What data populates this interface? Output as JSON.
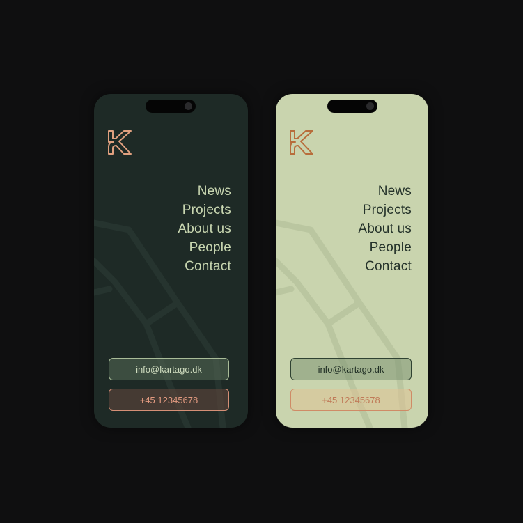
{
  "screens": [
    {
      "theme": "dark",
      "logo_icon": "kartago-k-logo-icon",
      "nav": [
        "News",
        "Projects",
        "About us",
        "People",
        "Contact"
      ],
      "email": "info@kartago.dk",
      "phone": "+45 12345678",
      "colors": {
        "background": "#1e2a26",
        "logo": "#e0a07f",
        "text": "#c9d7b1",
        "map_line": "#26342f"
      }
    },
    {
      "theme": "light",
      "logo_icon": "kartago-k-logo-icon",
      "nav": [
        "News",
        "Projects",
        "About us",
        "People",
        "Contact"
      ],
      "email": "info@kartago.dk",
      "phone": "+45 12345678",
      "colors": {
        "background": "#c9d4ae",
        "logo": "#b86d3b",
        "text": "#24322a",
        "map_line": "#bac6a0"
      }
    }
  ]
}
